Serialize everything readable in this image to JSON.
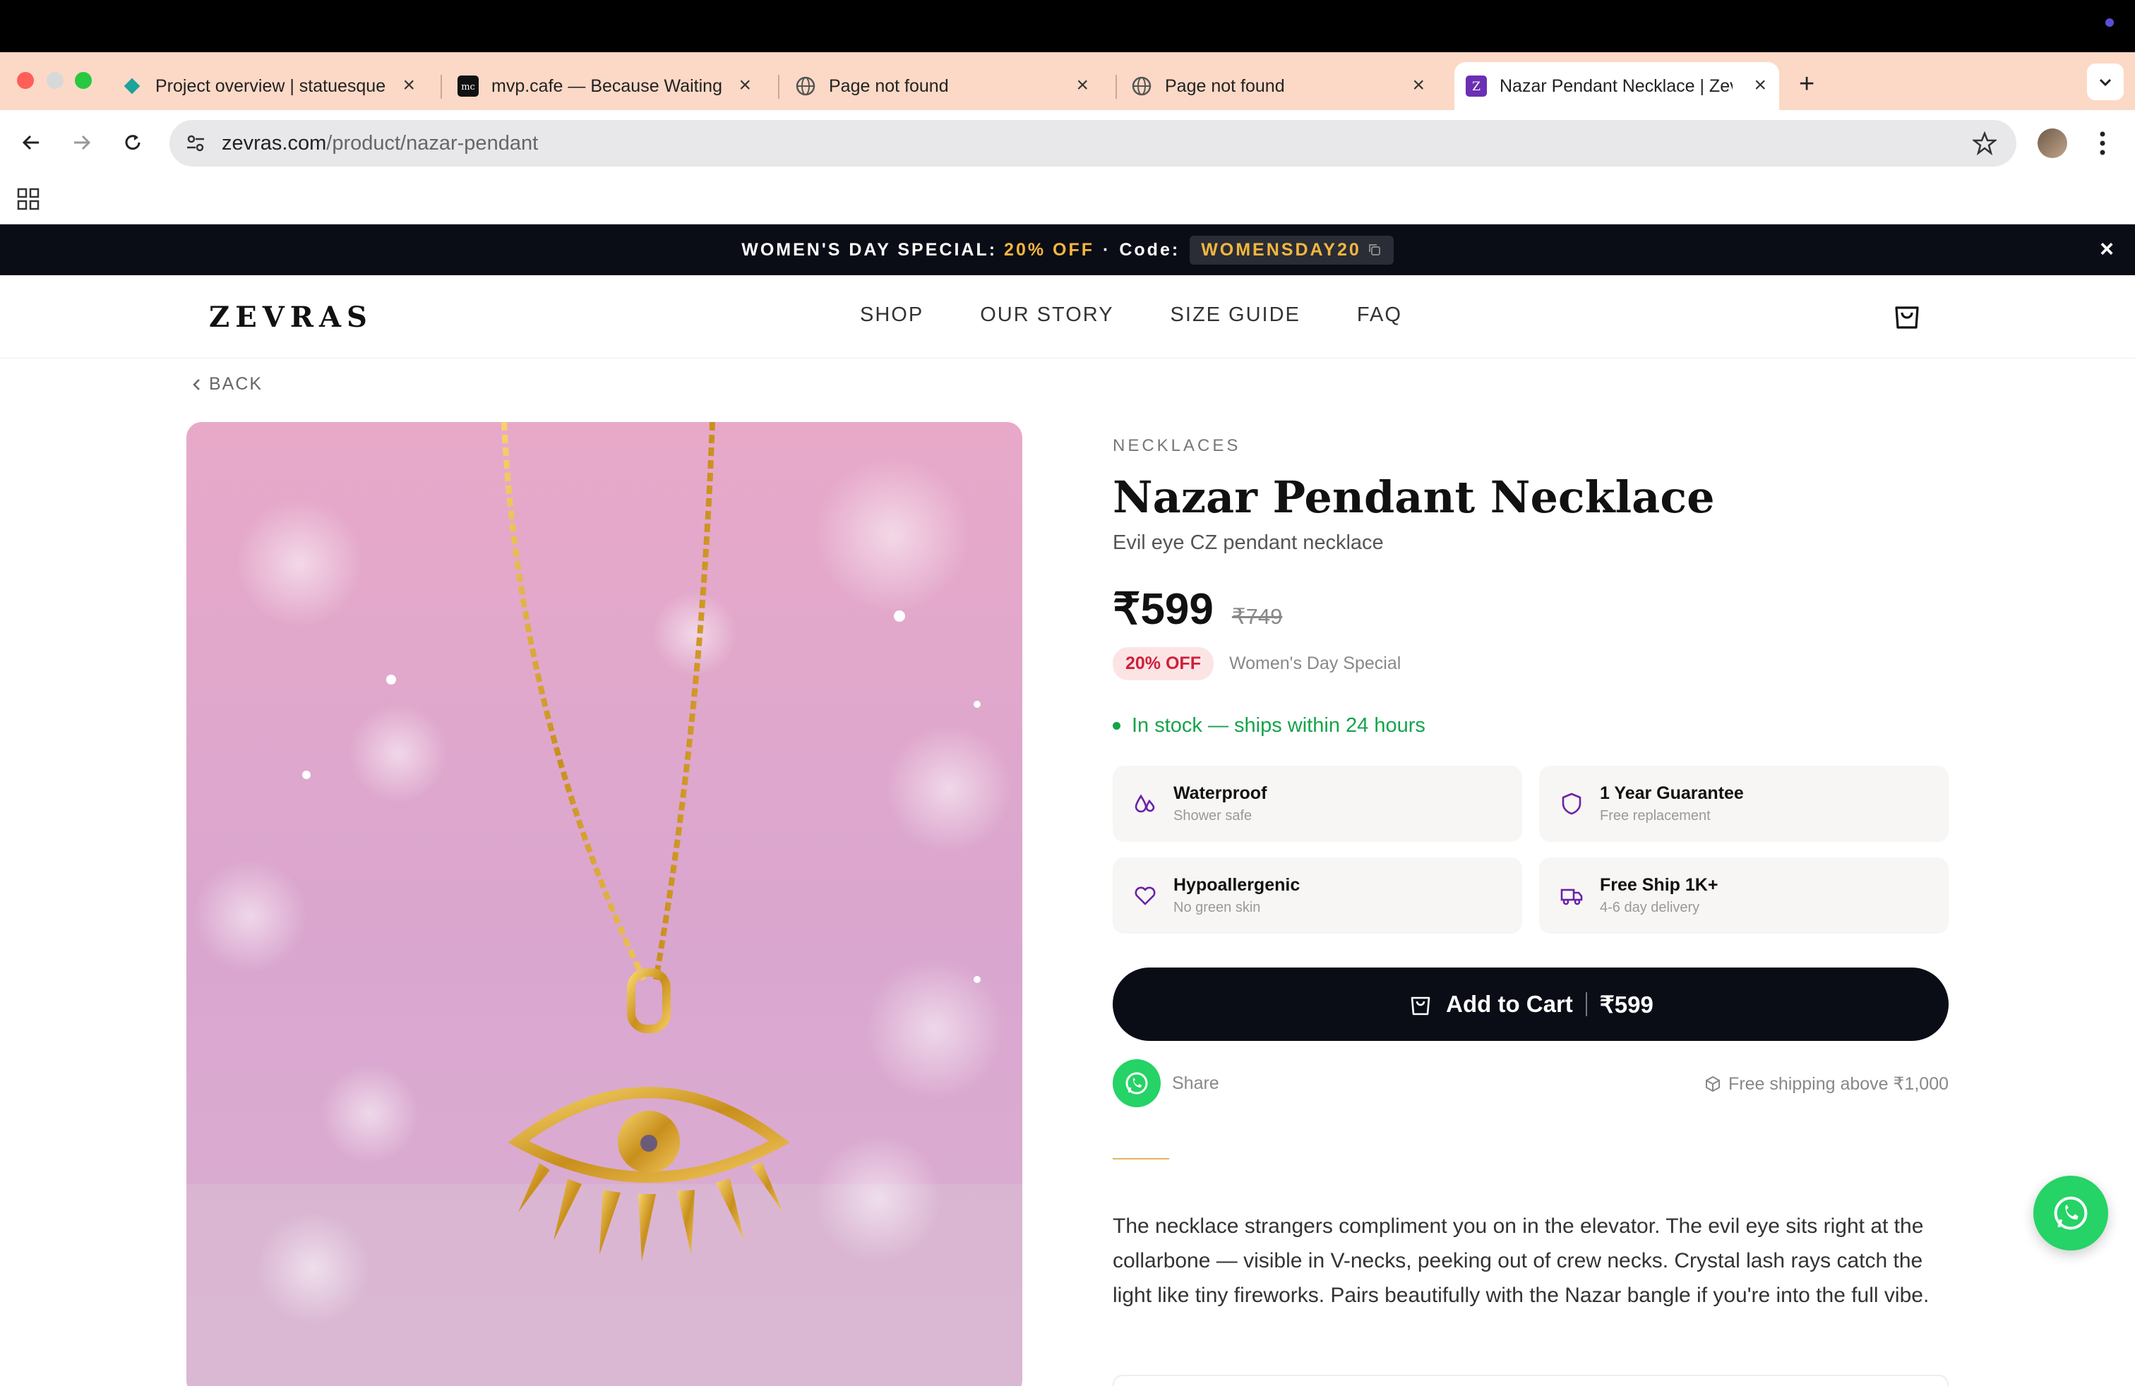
{
  "browser": {
    "tabs": [
      {
        "title": "Project overview | statuesque",
        "favicon": "teal-diamond-icon"
      },
      {
        "title": "mvp.cafe — Because Waiting",
        "favicon": "mc-logo-icon"
      },
      {
        "title": "Page not found",
        "favicon": "globe-icon"
      },
      {
        "title": "Page not found",
        "favicon": "globe-icon"
      },
      {
        "title": "Nazar Pendant Necklace | Zev",
        "favicon": "z-logo-icon",
        "active": true
      }
    ],
    "new_tab": "+",
    "url_domain": "zevras.com",
    "url_path": "/product/nazar-pendant"
  },
  "promo": {
    "label": "WOMEN'S DAY SPECIAL:",
    "discount": "20% OFF",
    "separator": "·",
    "code_label": "Code:",
    "code": "WOMENSDAY20"
  },
  "site": {
    "logo": "ZEVRAS",
    "nav": [
      "SHOP",
      "OUR STORY",
      "SIZE GUIDE",
      "FAQ"
    ]
  },
  "back_label": "BACK",
  "product": {
    "category": "NECKLACES",
    "title": "Nazar Pendant Necklace",
    "subtitle": "Evil eye CZ pendant necklace",
    "price": "₹599",
    "old_price": "₹749",
    "off_badge": "20% OFF",
    "off_note": "Women's Day Special",
    "stock": "In stock — ships within 24 hours",
    "features": [
      {
        "label": "Waterproof",
        "sub": "Shower safe",
        "icon": "droplets-icon"
      },
      {
        "label": "1 Year Guarantee",
        "sub": "Free replacement",
        "icon": "shield-icon"
      },
      {
        "label": "Hypoallergenic",
        "sub": "No green skin",
        "icon": "heart-icon"
      },
      {
        "label": "Free Ship 1K+",
        "sub": "4-6 day delivery",
        "icon": "truck-icon"
      }
    ],
    "cta_label": "Add to Cart",
    "cta_price": "₹599",
    "share_label": "Share",
    "free_shipping": "Free shipping above ₹1,000",
    "description": "The necklace strangers compliment you on in the elevator. The evil eye sits right at the collarbone — visible in V-necks, peeking out of crew necks. Crystal lash rays catch the light like tiny fireworks. Pairs beautifully with the Nazar bangle if you're into the full vibe."
  },
  "colors": {
    "accent_gold": "#f4b63f",
    "dark": "#0a0d16",
    "in_stock": "#16a34a",
    "sale_red": "#d11f3c",
    "whatsapp": "#25d366",
    "icon_purple": "#6b21a8"
  }
}
